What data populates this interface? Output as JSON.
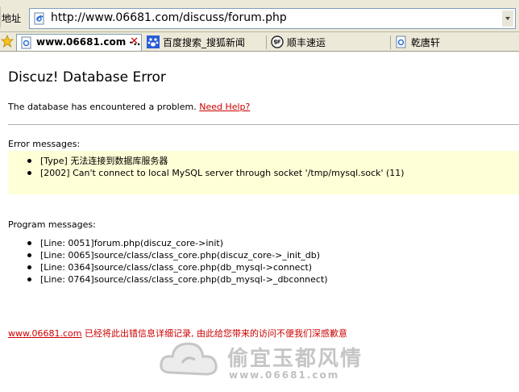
{
  "browser": {
    "address_label": "地址",
    "url": "http://www.06681.com/discuss/forum.php",
    "tabs": [
      {
        "label": "www.06681.com -...",
        "active": true
      },
      {
        "label": "百度搜索_搜狐新闻",
        "active": false
      },
      {
        "label": "顺丰速运",
        "active": false
      },
      {
        "label": "乾唐轩",
        "active": false
      }
    ],
    "tab_close": "✕"
  },
  "page": {
    "title": "Discuz! Database Error",
    "description": "The database has encountered a problem.",
    "help_link": "Need Help?",
    "error_label": "Error messages:",
    "errors": [
      "[Type] 无法连接到数据库服务器",
      "[2002] Can't connect to local MySQL server through socket '/tmp/mysql.sock' (11)"
    ],
    "program_label": "Program messages:",
    "program": [
      "[Line: 0051]forum.php(discuz_core->init)",
      "[Line: 0065]source/class/class_core.php(discuz_core->_init_db)",
      "[Line: 0364]source/class/class_core.php(db_mysql->connect)",
      "[Line: 0764]source/class/class_core.php(db_mysql->_dbconnect)"
    ],
    "footer_link": "www.06681.com",
    "footer_text": " 已经将此出错信息详细记录, 由此给您带来的访问不便我们深感歉意"
  },
  "watermark": {
    "text": "偷宜玉都风情",
    "url": "www.06681.com"
  },
  "colors": {
    "error_box": "#ffffd7",
    "link": "#cc0000",
    "chrome": "#ece9d8"
  }
}
